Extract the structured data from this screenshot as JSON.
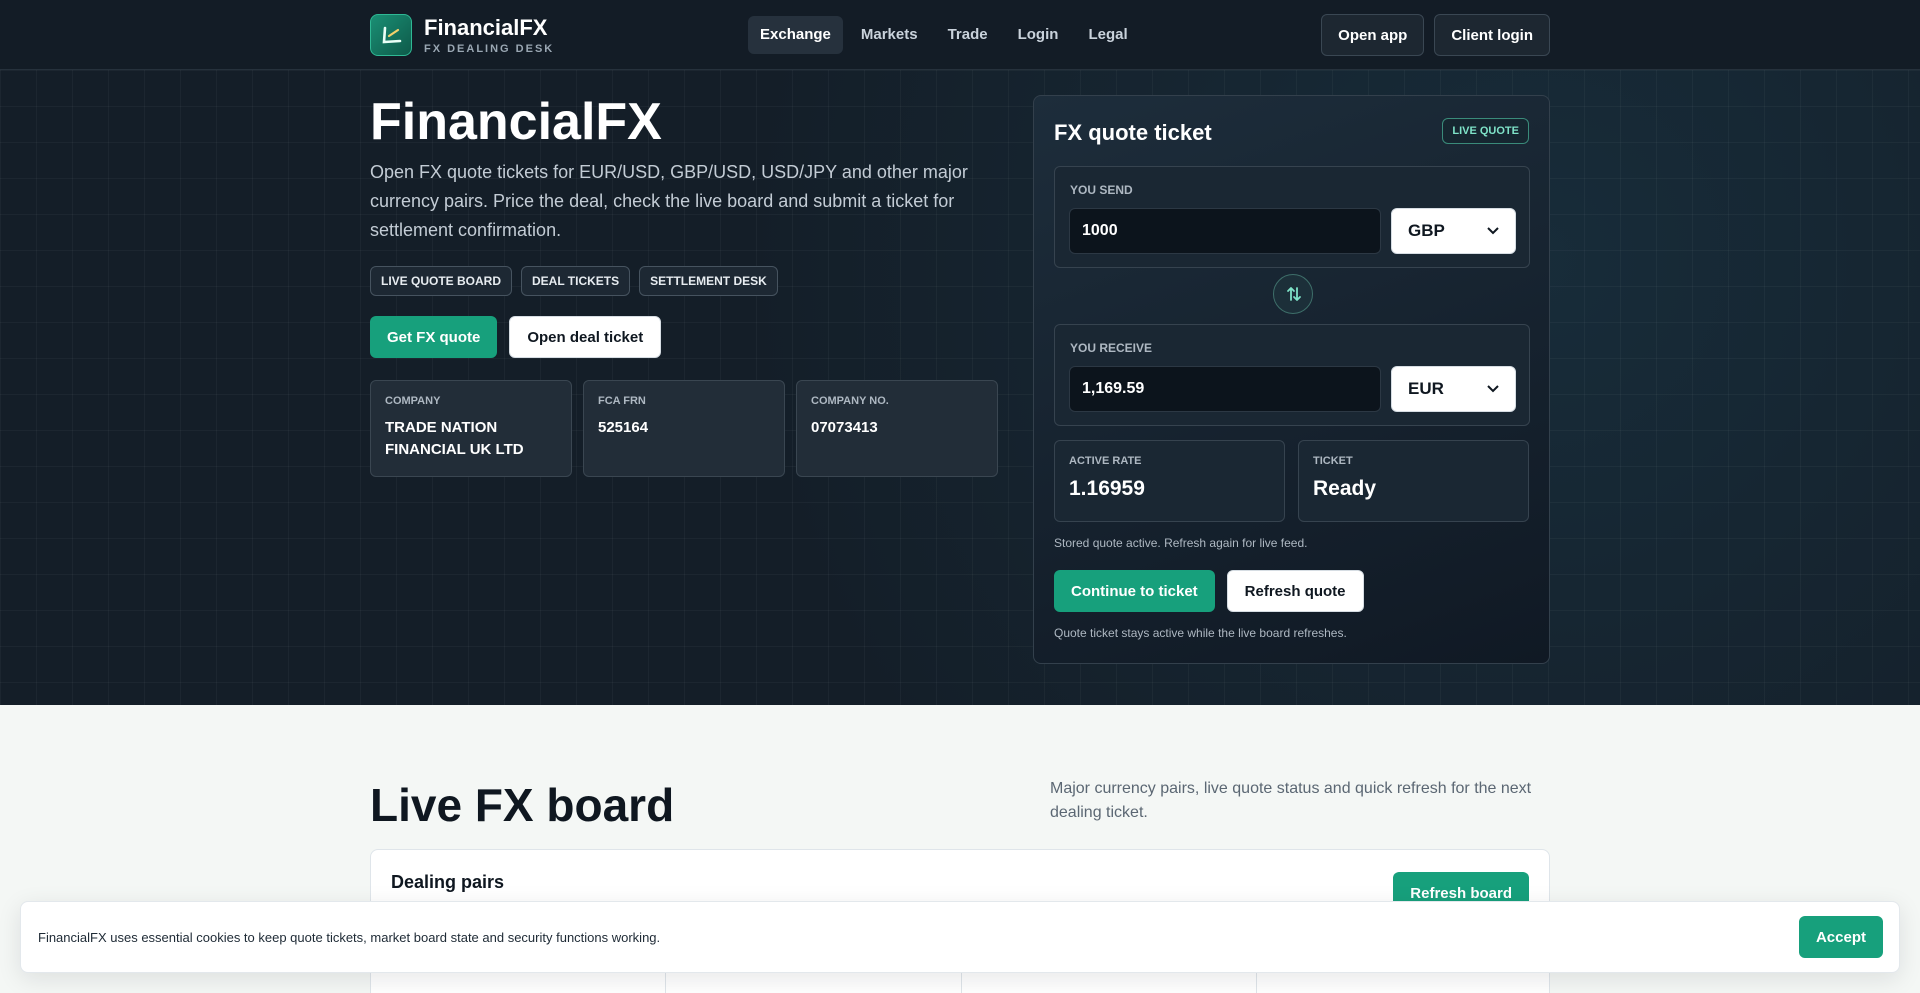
{
  "header": {
    "brand_name": "FinancialFX",
    "brand_sub": "FX DEALING DESK",
    "nav": [
      "Exchange",
      "Markets",
      "Trade",
      "Login",
      "Legal"
    ],
    "open_app": "Open app",
    "client_login": "Client login"
  },
  "hero": {
    "title": "FinancialFX",
    "description": "Open FX quote tickets for EUR/USD, GBP/USD, USD/JPY and other major currency pairs. Price the deal, check the live board and submit a ticket for settlement confirmation.",
    "chips": [
      "LIVE QUOTE BOARD",
      "DEAL TICKETS",
      "SETTLEMENT DESK"
    ],
    "cta_primary": "Get FX quote",
    "cta_secondary": "Open deal ticket",
    "facts": [
      {
        "label": "COMPANY",
        "value": "TRADE NATION FINANCIAL UK LTD"
      },
      {
        "label": "FCA FRN",
        "value": "525164"
      },
      {
        "label": "COMPANY NO.",
        "value": "07073413"
      }
    ]
  },
  "ticket": {
    "title": "FX quote ticket",
    "badge": "LIVE QUOTE",
    "send_label": "YOU SEND",
    "send_amount": "1000",
    "send_currency": "GBP",
    "receive_label": "YOU RECEIVE",
    "receive_amount": "1,169.59",
    "receive_currency": "EUR",
    "rate_label": "ACTIVE RATE",
    "rate_value": "1.16959",
    "status_label": "TICKET",
    "status_value": "Ready",
    "note": "Stored quote active. Refresh again for live feed.",
    "continue_label": "Continue to ticket",
    "refresh_label": "Refresh quote",
    "footnote": "Quote ticket stays active while the live board refreshes."
  },
  "board": {
    "title": "Live FX board",
    "description": "Major currency pairs, live quote status and quick refresh for the next dealing ticket.",
    "card_title": "Dealing pairs",
    "refresh_label": "Refresh board"
  },
  "cookie": {
    "text": "FinancialFX uses essential cookies to keep quote tickets, market board state and security functions working.",
    "accept": "Accept"
  },
  "colors": {
    "accent": "#17a07c",
    "header_bg": "#131c26",
    "hero_bg": "#141e28"
  }
}
